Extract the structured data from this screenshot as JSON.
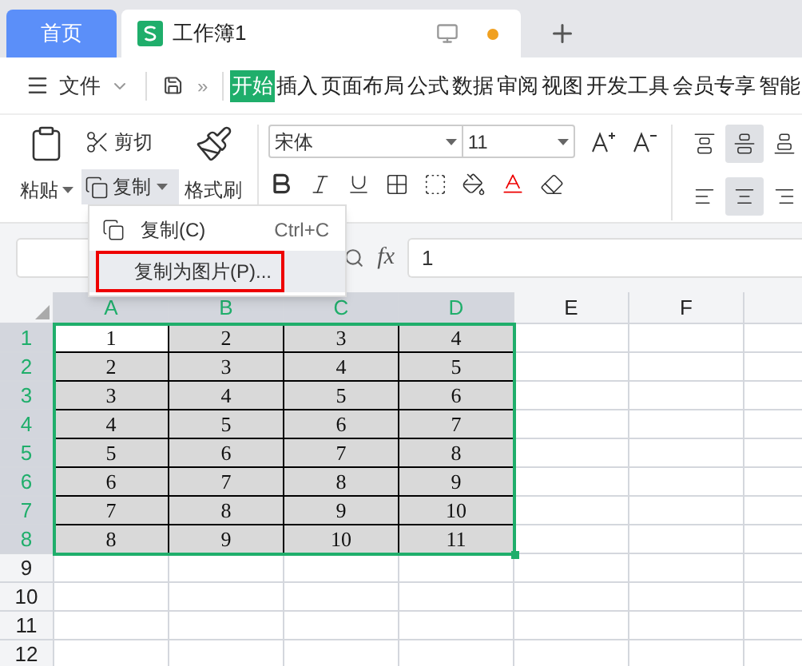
{
  "tabs": [
    {
      "label": "首页",
      "kind": "home",
      "selected": false
    },
    {
      "label": "工作簿1",
      "kind": "doc",
      "selected": true
    }
  ],
  "menu": {
    "file": "文件",
    "more": "»",
    "items": [
      {
        "label": "开始",
        "selected": true
      },
      {
        "label": "插入",
        "selected": false
      },
      {
        "label": "页面布局",
        "selected": false
      },
      {
        "label": "公式",
        "selected": false
      },
      {
        "label": "数据",
        "selected": false
      },
      {
        "label": "审阅",
        "selected": false
      },
      {
        "label": "视图",
        "selected": false
      },
      {
        "label": "开发工具",
        "selected": false
      },
      {
        "label": "会员专享",
        "selected": false
      },
      {
        "label": "智能",
        "selected": false
      }
    ]
  },
  "ribbon": {
    "paste": "粘贴",
    "cut": "剪切",
    "copy": {
      "label": "复制",
      "expanded": true
    },
    "format_painter": "格式刷",
    "font": "宋体",
    "size": "11",
    "align": [
      {
        "kind": "top",
        "selected": false
      },
      {
        "kind": "middle",
        "selected": true
      },
      {
        "kind": "bottom",
        "selected": false
      },
      {
        "kind": "left",
        "selected": false
      },
      {
        "kind": "center",
        "selected": true
      },
      {
        "kind": "right",
        "selected": false
      }
    ]
  },
  "copy_menu": [
    {
      "label": "复制(C)",
      "shortcut": "Ctrl+C",
      "kind": "icon",
      "selected": false
    },
    {
      "label": "复制为图片(P)...",
      "kind": "plain",
      "selected": true
    }
  ],
  "formula_bar": {
    "fx": "fx",
    "value": "1"
  },
  "columns": [
    {
      "label": "A",
      "selected": true
    },
    {
      "label": "B",
      "selected": true
    },
    {
      "label": "C",
      "selected": true
    },
    {
      "label": "D",
      "selected": true
    },
    {
      "label": "E",
      "selected": false
    },
    {
      "label": "F",
      "selected": false
    }
  ],
  "rows": [
    {
      "label": "1",
      "selected": true,
      "cells": [
        {
          "text": "1",
          "active": true
        },
        {
          "text": "2",
          "active": false
        },
        {
          "text": "3",
          "active": false
        },
        {
          "text": "4",
          "active": false
        }
      ]
    },
    {
      "label": "2",
      "selected": true,
      "cells": [
        {
          "text": "2",
          "active": false
        },
        {
          "text": "3",
          "active": false
        },
        {
          "text": "4",
          "active": false
        },
        {
          "text": "5",
          "active": false
        }
      ]
    },
    {
      "label": "3",
      "selected": true,
      "cells": [
        {
          "text": "3",
          "active": false
        },
        {
          "text": "4",
          "active": false
        },
        {
          "text": "5",
          "active": false
        },
        {
          "text": "6",
          "active": false
        }
      ]
    },
    {
      "label": "4",
      "selected": true,
      "cells": [
        {
          "text": "4",
          "active": false
        },
        {
          "text": "5",
          "active": false
        },
        {
          "text": "6",
          "active": false
        },
        {
          "text": "7",
          "active": false
        }
      ]
    },
    {
      "label": "5",
      "selected": true,
      "cells": [
        {
          "text": "5",
          "active": false
        },
        {
          "text": "6",
          "active": false
        },
        {
          "text": "7",
          "active": false
        },
        {
          "text": "8",
          "active": false
        }
      ]
    },
    {
      "label": "6",
      "selected": true,
      "cells": [
        {
          "text": "6",
          "active": false
        },
        {
          "text": "7",
          "active": false
        },
        {
          "text": "8",
          "active": false
        },
        {
          "text": "9",
          "active": false
        }
      ]
    },
    {
      "label": "7",
      "selected": true,
      "cells": [
        {
          "text": "7",
          "active": false
        },
        {
          "text": "8",
          "active": false
        },
        {
          "text": "9",
          "active": false
        },
        {
          "text": "10",
          "active": false
        }
      ]
    },
    {
      "label": "8",
      "selected": true,
      "cells": [
        {
          "text": "8",
          "active": false
        },
        {
          "text": "9",
          "active": false
        },
        {
          "text": "10",
          "active": false
        },
        {
          "text": "11",
          "active": false
        }
      ]
    },
    {
      "label": "9",
      "selected": false,
      "cells": []
    },
    {
      "label": "10",
      "selected": false,
      "cells": []
    },
    {
      "label": "11",
      "selected": false,
      "cells": []
    },
    {
      "label": "12",
      "selected": false,
      "cells": []
    }
  ]
}
